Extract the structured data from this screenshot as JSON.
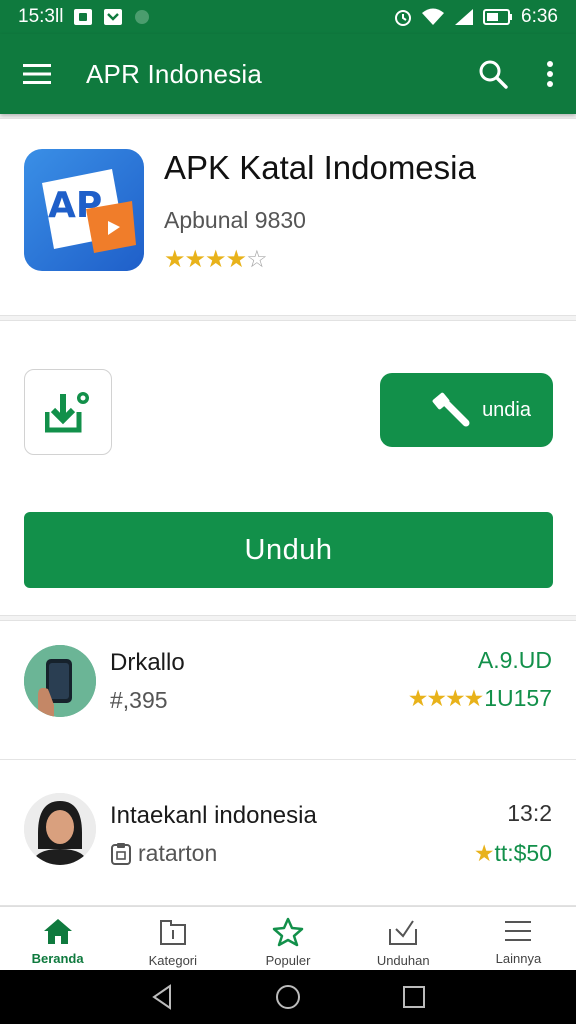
{
  "status_bar": {
    "time_left": "15:3ll",
    "time_right": "6:36"
  },
  "app_bar": {
    "title": "APR Indonesia",
    "icons": [
      "menu-icon",
      "search-icon",
      "more-vert-icon"
    ]
  },
  "app_card": {
    "name": "APK Katal Indomesia",
    "subtitle": "Apbunal 9830",
    "rating_stars": 4,
    "rating_max": 5,
    "logo_text": "AP"
  },
  "actions": {
    "pill_label": "undia",
    "big_button_label": "Unduh"
  },
  "list": [
    {
      "title": "Drkallo",
      "subtitle": "#,395",
      "meta": "A.9.UD",
      "rating_text": "1U157",
      "stars": 4
    },
    {
      "title": "Intaekanl indonesia",
      "subtitle": "ratarton",
      "meta": "13:2",
      "rating_text": "tt:$50",
      "stars": 1
    }
  ],
  "bottom_nav": [
    {
      "label": "Beranda",
      "icon": "home-icon",
      "active": true
    },
    {
      "label": "Kategori",
      "icon": "folder-icon",
      "active": false
    },
    {
      "label": "Populer",
      "icon": "star-icon",
      "active": false
    },
    {
      "label": "Unduhan",
      "icon": "download-tray-icon",
      "active": false
    },
    {
      "label": "Lainnya",
      "icon": "hamburger-icon",
      "active": false
    }
  ],
  "colors": {
    "primary": "#0f7a3e",
    "button_green": "#12904a",
    "star": "#e8b21a",
    "logo_blue": "#2a76d8",
    "logo_orange": "#f07d2a"
  }
}
